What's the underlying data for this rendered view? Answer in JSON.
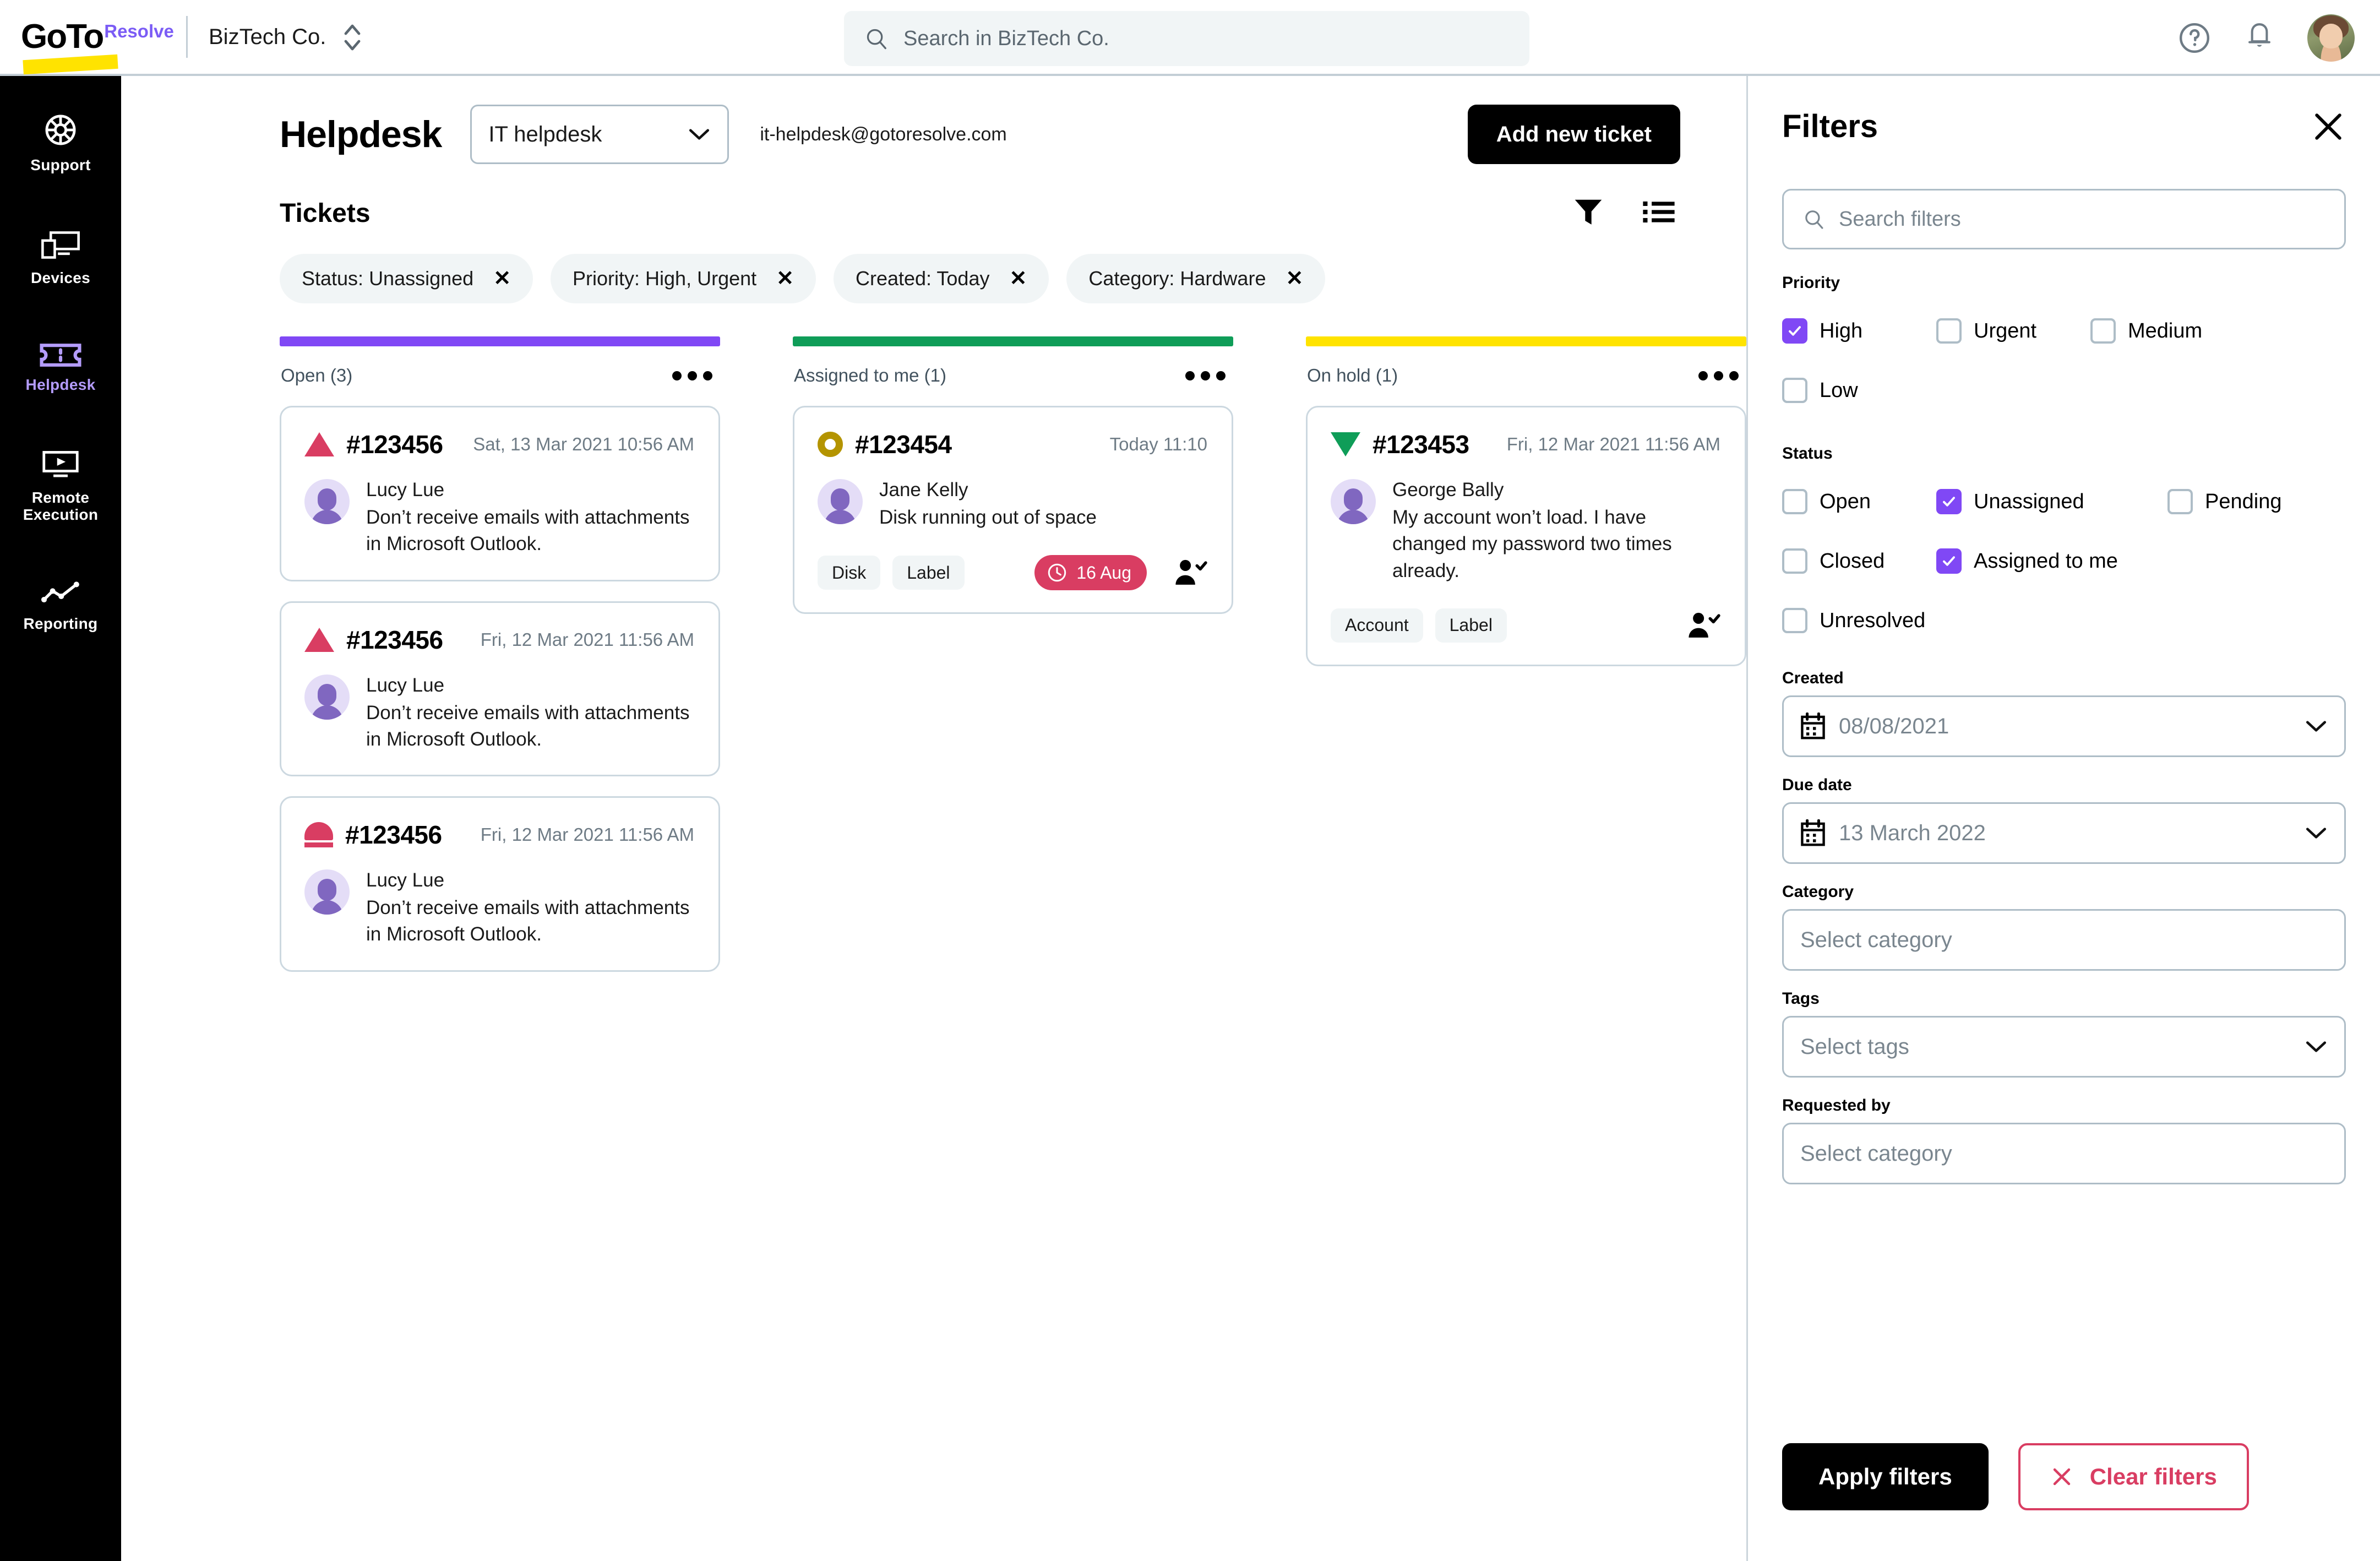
{
  "topbar": {
    "logo_goto": "GoTo",
    "logo_resolve": "Resolve",
    "org_name": "BizTech Co.",
    "search_placeholder": "Search in BizTech Co."
  },
  "sidebar": {
    "items": [
      {
        "label": "Support",
        "icon": "support-wheel-icon",
        "active": false
      },
      {
        "label": "Devices",
        "icon": "devices-icon",
        "active": false
      },
      {
        "label": "Helpdesk",
        "icon": "ticket-icon",
        "active": true
      },
      {
        "label": "Remote Execution",
        "icon": "monitor-play-icon",
        "active": false
      },
      {
        "label": "Reporting",
        "icon": "line-chart-icon",
        "active": false
      }
    ]
  },
  "page": {
    "title": "Helpdesk",
    "helpdesk_select": "IT helpdesk",
    "helpdesk_email": "it-helpdesk@gotoresolve.com",
    "add_ticket_label": "Add new ticket",
    "tickets_heading": "Tickets"
  },
  "chips": [
    {
      "label": "Status: Unassigned"
    },
    {
      "label": "Priority: High, Urgent"
    },
    {
      "label": "Created: Today"
    },
    {
      "label": "Category: Hardware"
    }
  ],
  "board": {
    "columns": [
      {
        "name": "Open (3)",
        "color": "#8048f5",
        "cards": [
          {
            "priority": "high",
            "id": "#123456",
            "date": "Sat, 13 Mar 2021 10:56 AM",
            "user": "Lucy Lue",
            "message": "Don’t receive emails with attachments in Microsoft Outlook.",
            "tags": [],
            "due": null,
            "assign": false
          },
          {
            "priority": "high",
            "id": "#123456",
            "date": "Fri, 12 Mar 2021 11:56 AM",
            "user": "Lucy Lue",
            "message": "Don’t receive emails with attachments in Microsoft Outlook.",
            "tags": [],
            "due": null,
            "assign": false
          },
          {
            "priority": "urgent",
            "id": "#123456",
            "date": "Fri, 12 Mar 2021 11:56 AM",
            "user": "Lucy Lue",
            "message": "Don’t receive emails with attachments in Microsoft Outlook.",
            "tags": [],
            "due": null,
            "assign": false
          }
        ]
      },
      {
        "name": "Assigned to me (1)",
        "color": "#0f9d58",
        "cards": [
          {
            "priority": "medium",
            "id": "#123454",
            "date": "Today 11:10",
            "user": "Jane Kelly",
            "message": "Disk running out of space",
            "tags": [
              "Disk",
              "Label"
            ],
            "due": "16 Aug",
            "assign": true
          }
        ]
      },
      {
        "name": "On hold (1)",
        "color": "#ffe300",
        "cards": [
          {
            "priority": "low",
            "id": "#123453",
            "date": "Fri, 12 Mar 2021 11:56 AM",
            "user": "George Bally",
            "message": "My account won’t load. I have changed my password two times already.",
            "tags": [
              "Account",
              "Label"
            ],
            "due": null,
            "assign": true
          }
        ]
      }
    ]
  },
  "filters": {
    "title": "Filters",
    "search_placeholder": "Search filters",
    "priority": {
      "label": "Priority",
      "options": [
        {
          "label": "High",
          "checked": true
        },
        {
          "label": "Urgent",
          "checked": false
        },
        {
          "label": "Medium",
          "checked": false
        },
        {
          "label": "Low",
          "checked": false
        }
      ]
    },
    "status": {
      "label": "Status",
      "options": [
        {
          "label": "Open",
          "checked": false
        },
        {
          "label": "Unassigned",
          "checked": true
        },
        {
          "label": "Pending",
          "checked": false
        },
        {
          "label": "Closed",
          "checked": false
        },
        {
          "label": "Assigned to me",
          "checked": true
        },
        {
          "label": "Unresolved",
          "checked": false
        }
      ]
    },
    "created": {
      "label": "Created",
      "value": "08/08/2021"
    },
    "due_date": {
      "label": "Due date",
      "value": "13 March 2022"
    },
    "category": {
      "label": "Category",
      "value": "Select category"
    },
    "tags": {
      "label": "Tags",
      "value": "Select tags"
    },
    "requested_by": {
      "label": "Requested by",
      "value": "Select category"
    },
    "apply_label": "Apply filters",
    "clear_label": "Clear filters"
  },
  "colors": {
    "accent_purple": "#8048f5",
    "brand_yellow": "#ffe300",
    "danger_pink": "#d93d62",
    "green": "#0f9d58",
    "medium_gold": "#b49400"
  }
}
